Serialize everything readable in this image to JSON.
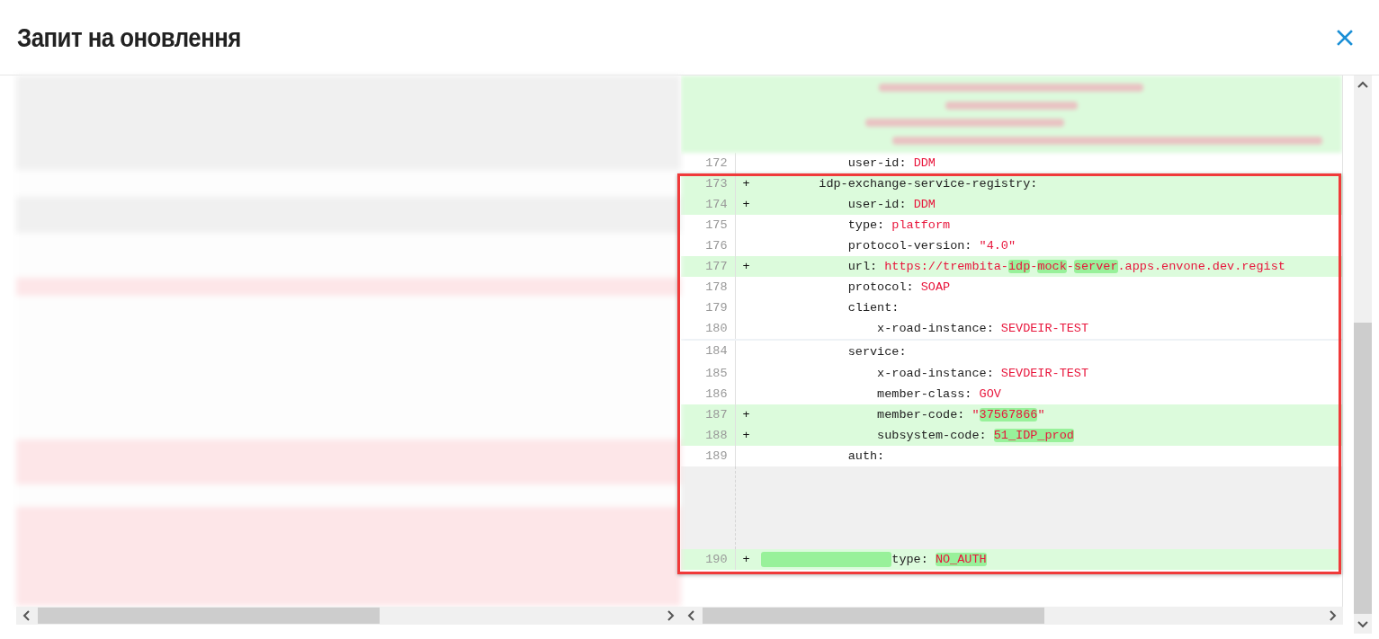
{
  "dialog": {
    "title": "Запит на оновлення"
  },
  "diff": {
    "right_lines": [
      {
        "kind": "line",
        "number": "172",
        "added": false,
        "break_before": false,
        "tokens": [
          {
            "text": "            user-id: ",
            "kind": "key",
            "highlight": false
          },
          {
            "text": "DDM",
            "kind": "value",
            "highlight": false
          }
        ]
      },
      {
        "kind": "line",
        "number": "173",
        "marker": "+",
        "added": true,
        "break_before": false,
        "tokens": [
          {
            "text": "        idp-exchange-service-registry:",
            "kind": "key",
            "highlight": false
          }
        ]
      },
      {
        "kind": "line",
        "number": "174",
        "marker": "+",
        "added": true,
        "break_before": false,
        "tokens": [
          {
            "text": "            user-id: ",
            "kind": "key",
            "highlight": false
          },
          {
            "text": "DDM",
            "kind": "value",
            "highlight": false
          }
        ]
      },
      {
        "kind": "line",
        "number": "175",
        "added": false,
        "break_before": false,
        "tokens": [
          {
            "text": "            type: ",
            "kind": "key",
            "highlight": false
          },
          {
            "text": "platform",
            "kind": "value",
            "highlight": false
          }
        ]
      },
      {
        "kind": "line",
        "number": "176",
        "added": false,
        "break_before": false,
        "tokens": [
          {
            "text": "            protocol-version: ",
            "kind": "key",
            "highlight": false
          },
          {
            "text": "\"4.0\"",
            "kind": "value",
            "highlight": false
          }
        ]
      },
      {
        "kind": "line",
        "number": "177",
        "marker": "+",
        "added": true,
        "break_before": false,
        "tokens": [
          {
            "text": "            url: ",
            "kind": "key",
            "highlight": false
          },
          {
            "text": "https://trembita-",
            "kind": "value",
            "highlight": false
          },
          {
            "text": "idp",
            "kind": "value",
            "highlight": true
          },
          {
            "text": "-",
            "kind": "value",
            "highlight": false
          },
          {
            "text": "mock",
            "kind": "value",
            "highlight": true
          },
          {
            "text": "-",
            "kind": "value",
            "highlight": false
          },
          {
            "text": "server",
            "kind": "value",
            "highlight": true
          },
          {
            "text": ".apps.envone.dev.regist",
            "kind": "value",
            "highlight": false
          }
        ]
      },
      {
        "kind": "line",
        "number": "178",
        "added": false,
        "break_before": false,
        "tokens": [
          {
            "text": "            protocol: ",
            "kind": "key",
            "highlight": false
          },
          {
            "text": "SOAP",
            "kind": "value",
            "highlight": false
          }
        ]
      },
      {
        "kind": "line",
        "number": "179",
        "added": false,
        "break_before": false,
        "tokens": [
          {
            "text": "            client:",
            "kind": "key",
            "highlight": false
          }
        ]
      },
      {
        "kind": "line",
        "number": "180",
        "added": false,
        "break_before": false,
        "tokens": [
          {
            "text": "                x-road-instance: ",
            "kind": "key",
            "highlight": false
          },
          {
            "text": "SEVDEIR-TEST",
            "kind": "value",
            "highlight": false
          }
        ]
      },
      {
        "kind": "line",
        "number": "184",
        "added": false,
        "break_before": true,
        "tokens": [
          {
            "text": "            service:",
            "kind": "key",
            "highlight": false
          }
        ]
      },
      {
        "kind": "line",
        "number": "185",
        "added": false,
        "break_before": false,
        "tokens": [
          {
            "text": "                x-road-instance: ",
            "kind": "key",
            "highlight": false
          },
          {
            "text": "SEVDEIR-TEST",
            "kind": "value",
            "highlight": false
          }
        ]
      },
      {
        "kind": "line",
        "number": "186",
        "added": false,
        "break_before": false,
        "tokens": [
          {
            "text": "                member-class: ",
            "kind": "key",
            "highlight": false
          },
          {
            "text": "GOV",
            "kind": "value",
            "highlight": false
          }
        ]
      },
      {
        "kind": "line",
        "number": "187",
        "marker": "+",
        "added": true,
        "break_before": false,
        "tokens": [
          {
            "text": "                member-code: ",
            "kind": "key",
            "highlight": false
          },
          {
            "text": "\"",
            "kind": "value",
            "highlight": false
          },
          {
            "text": "37567866",
            "kind": "value",
            "highlight": true
          },
          {
            "text": "\"",
            "kind": "value",
            "highlight": false
          }
        ]
      },
      {
        "kind": "line",
        "number": "188",
        "marker": "+",
        "added": true,
        "break_before": false,
        "tokens": [
          {
            "text": "                subsystem-code: ",
            "kind": "key",
            "highlight": false
          },
          {
            "text": "51_IDP_prod",
            "kind": "value",
            "highlight": true
          }
        ]
      },
      {
        "kind": "line",
        "number": "189",
        "added": false,
        "break_before": false,
        "tokens": [
          {
            "text": "            auth:",
            "kind": "key",
            "highlight": false
          }
        ]
      },
      {
        "kind": "gap"
      },
      {
        "kind": "line",
        "number": "190",
        "marker": "+",
        "added": true,
        "break_before": false,
        "tokens": [
          {
            "kind": "whitespace",
            "highlight": true
          },
          {
            "text": "type: ",
            "kind": "key",
            "highlight": false
          },
          {
            "text": "NO_AUTH",
            "kind": "value",
            "highlight": true
          }
        ]
      }
    ]
  }
}
